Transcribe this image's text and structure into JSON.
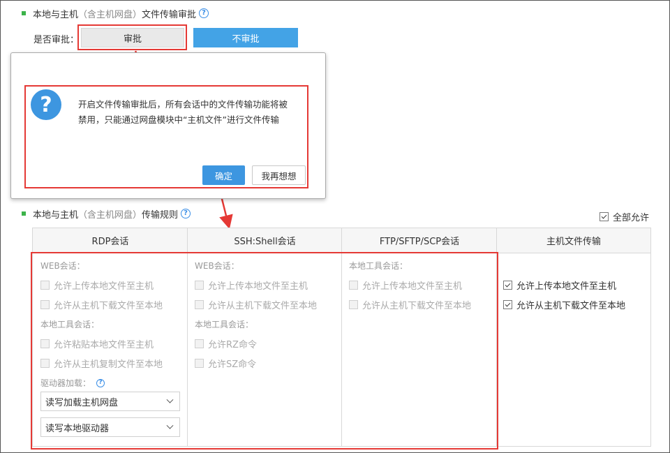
{
  "approval_section": {
    "title": "本地与主机",
    "subtitle": "（含主机网盘）",
    "title_suffix": "文件传输审批",
    "help_icon": "question-circle-icon",
    "label": "是否审批：",
    "approve_label": "审批",
    "no_approve_label": "不审批"
  },
  "dialog": {
    "icon": "question-icon",
    "message_line1": "开启文件传输审批后，所有会话中的文件传输功能将被",
    "message_line2": "禁用，只能通过网盘模块中“主机文件”进行文件传输",
    "ok_label": "确定",
    "cancel_label": "我再想想"
  },
  "rules_section": {
    "title": "本地与主机",
    "subtitle": "（含主机网盘）",
    "title_suffix": "传输规则",
    "help_icon": "question-circle-icon",
    "allow_all_label": "全部允许",
    "allow_all_checked": true
  },
  "columns": {
    "rdp": {
      "header": "RDP会话",
      "web_label": "WEB会话：",
      "web_upload": "允许上传本地文件至主机",
      "web_download": "允许从主机下载文件至本地",
      "tool_label": "本地工具会话：",
      "tool_paste": "允许粘贴本地文件至主机",
      "tool_copy": "允许从主机复制文件至本地",
      "drive_label": "驱动器加载：",
      "drive_select1": "读写加载主机网盘",
      "drive_select2": "读写本地驱动器"
    },
    "ssh": {
      "header": "SSH:Shell会话",
      "web_label": "WEB会话：",
      "web_upload": "允许上传本地文件至主机",
      "web_download": "允许从主机下载文件至本地",
      "tool_label": "本地工具会话：",
      "tool_rz": "允许RZ命令",
      "tool_sz": "允许SZ命令"
    },
    "ftp": {
      "header": "FTP/SFTP/SCP会话",
      "tool_label": "本地工具会话：",
      "tool_upload": "允许上传本地文件至主机",
      "tool_download": "允许从主机下载文件至本地"
    },
    "host": {
      "header": "主机文件传输",
      "upload": "允许上传本地文件至主机",
      "download": "允许从主机下载文件至本地"
    }
  },
  "colors": {
    "accent_blue": "#43a3e6",
    "highlight_red": "#e53935",
    "bullet_green": "#3cb34a"
  }
}
